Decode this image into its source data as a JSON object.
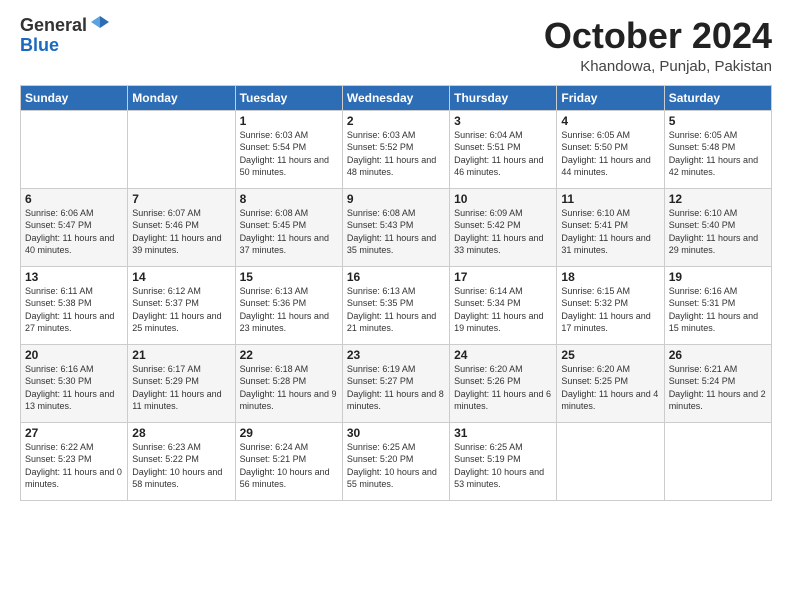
{
  "logo": {
    "general": "General",
    "blue": "Blue"
  },
  "title": "October 2024",
  "location": "Khandowa, Punjab, Pakistan",
  "weekdays": [
    "Sunday",
    "Monday",
    "Tuesday",
    "Wednesday",
    "Thursday",
    "Friday",
    "Saturday"
  ],
  "weeks": [
    [
      {
        "day": "",
        "sunrise": "",
        "sunset": "",
        "daylight": ""
      },
      {
        "day": "",
        "sunrise": "",
        "sunset": "",
        "daylight": ""
      },
      {
        "day": "1",
        "sunrise": "Sunrise: 6:03 AM",
        "sunset": "Sunset: 5:54 PM",
        "daylight": "Daylight: 11 hours and 50 minutes."
      },
      {
        "day": "2",
        "sunrise": "Sunrise: 6:03 AM",
        "sunset": "Sunset: 5:52 PM",
        "daylight": "Daylight: 11 hours and 48 minutes."
      },
      {
        "day": "3",
        "sunrise": "Sunrise: 6:04 AM",
        "sunset": "Sunset: 5:51 PM",
        "daylight": "Daylight: 11 hours and 46 minutes."
      },
      {
        "day": "4",
        "sunrise": "Sunrise: 6:05 AM",
        "sunset": "Sunset: 5:50 PM",
        "daylight": "Daylight: 11 hours and 44 minutes."
      },
      {
        "day": "5",
        "sunrise": "Sunrise: 6:05 AM",
        "sunset": "Sunset: 5:48 PM",
        "daylight": "Daylight: 11 hours and 42 minutes."
      }
    ],
    [
      {
        "day": "6",
        "sunrise": "Sunrise: 6:06 AM",
        "sunset": "Sunset: 5:47 PM",
        "daylight": "Daylight: 11 hours and 40 minutes."
      },
      {
        "day": "7",
        "sunrise": "Sunrise: 6:07 AM",
        "sunset": "Sunset: 5:46 PM",
        "daylight": "Daylight: 11 hours and 39 minutes."
      },
      {
        "day": "8",
        "sunrise": "Sunrise: 6:08 AM",
        "sunset": "Sunset: 5:45 PM",
        "daylight": "Daylight: 11 hours and 37 minutes."
      },
      {
        "day": "9",
        "sunrise": "Sunrise: 6:08 AM",
        "sunset": "Sunset: 5:43 PM",
        "daylight": "Daylight: 11 hours and 35 minutes."
      },
      {
        "day": "10",
        "sunrise": "Sunrise: 6:09 AM",
        "sunset": "Sunset: 5:42 PM",
        "daylight": "Daylight: 11 hours and 33 minutes."
      },
      {
        "day": "11",
        "sunrise": "Sunrise: 6:10 AM",
        "sunset": "Sunset: 5:41 PM",
        "daylight": "Daylight: 11 hours and 31 minutes."
      },
      {
        "day": "12",
        "sunrise": "Sunrise: 6:10 AM",
        "sunset": "Sunset: 5:40 PM",
        "daylight": "Daylight: 11 hours and 29 minutes."
      }
    ],
    [
      {
        "day": "13",
        "sunrise": "Sunrise: 6:11 AM",
        "sunset": "Sunset: 5:38 PM",
        "daylight": "Daylight: 11 hours and 27 minutes."
      },
      {
        "day": "14",
        "sunrise": "Sunrise: 6:12 AM",
        "sunset": "Sunset: 5:37 PM",
        "daylight": "Daylight: 11 hours and 25 minutes."
      },
      {
        "day": "15",
        "sunrise": "Sunrise: 6:13 AM",
        "sunset": "Sunset: 5:36 PM",
        "daylight": "Daylight: 11 hours and 23 minutes."
      },
      {
        "day": "16",
        "sunrise": "Sunrise: 6:13 AM",
        "sunset": "Sunset: 5:35 PM",
        "daylight": "Daylight: 11 hours and 21 minutes."
      },
      {
        "day": "17",
        "sunrise": "Sunrise: 6:14 AM",
        "sunset": "Sunset: 5:34 PM",
        "daylight": "Daylight: 11 hours and 19 minutes."
      },
      {
        "day": "18",
        "sunrise": "Sunrise: 6:15 AM",
        "sunset": "Sunset: 5:32 PM",
        "daylight": "Daylight: 11 hours and 17 minutes."
      },
      {
        "day": "19",
        "sunrise": "Sunrise: 6:16 AM",
        "sunset": "Sunset: 5:31 PM",
        "daylight": "Daylight: 11 hours and 15 minutes."
      }
    ],
    [
      {
        "day": "20",
        "sunrise": "Sunrise: 6:16 AM",
        "sunset": "Sunset: 5:30 PM",
        "daylight": "Daylight: 11 hours and 13 minutes."
      },
      {
        "day": "21",
        "sunrise": "Sunrise: 6:17 AM",
        "sunset": "Sunset: 5:29 PM",
        "daylight": "Daylight: 11 hours and 11 minutes."
      },
      {
        "day": "22",
        "sunrise": "Sunrise: 6:18 AM",
        "sunset": "Sunset: 5:28 PM",
        "daylight": "Daylight: 11 hours and 9 minutes."
      },
      {
        "day": "23",
        "sunrise": "Sunrise: 6:19 AM",
        "sunset": "Sunset: 5:27 PM",
        "daylight": "Daylight: 11 hours and 8 minutes."
      },
      {
        "day": "24",
        "sunrise": "Sunrise: 6:20 AM",
        "sunset": "Sunset: 5:26 PM",
        "daylight": "Daylight: 11 hours and 6 minutes."
      },
      {
        "day": "25",
        "sunrise": "Sunrise: 6:20 AM",
        "sunset": "Sunset: 5:25 PM",
        "daylight": "Daylight: 11 hours and 4 minutes."
      },
      {
        "day": "26",
        "sunrise": "Sunrise: 6:21 AM",
        "sunset": "Sunset: 5:24 PM",
        "daylight": "Daylight: 11 hours and 2 minutes."
      }
    ],
    [
      {
        "day": "27",
        "sunrise": "Sunrise: 6:22 AM",
        "sunset": "Sunset: 5:23 PM",
        "daylight": "Daylight: 11 hours and 0 minutes."
      },
      {
        "day": "28",
        "sunrise": "Sunrise: 6:23 AM",
        "sunset": "Sunset: 5:22 PM",
        "daylight": "Daylight: 10 hours and 58 minutes."
      },
      {
        "day": "29",
        "sunrise": "Sunrise: 6:24 AM",
        "sunset": "Sunset: 5:21 PM",
        "daylight": "Daylight: 10 hours and 56 minutes."
      },
      {
        "day": "30",
        "sunrise": "Sunrise: 6:25 AM",
        "sunset": "Sunset: 5:20 PM",
        "daylight": "Daylight: 10 hours and 55 minutes."
      },
      {
        "day": "31",
        "sunrise": "Sunrise: 6:25 AM",
        "sunset": "Sunset: 5:19 PM",
        "daylight": "Daylight: 10 hours and 53 minutes."
      },
      {
        "day": "",
        "sunrise": "",
        "sunset": "",
        "daylight": ""
      },
      {
        "day": "",
        "sunrise": "",
        "sunset": "",
        "daylight": ""
      }
    ]
  ]
}
